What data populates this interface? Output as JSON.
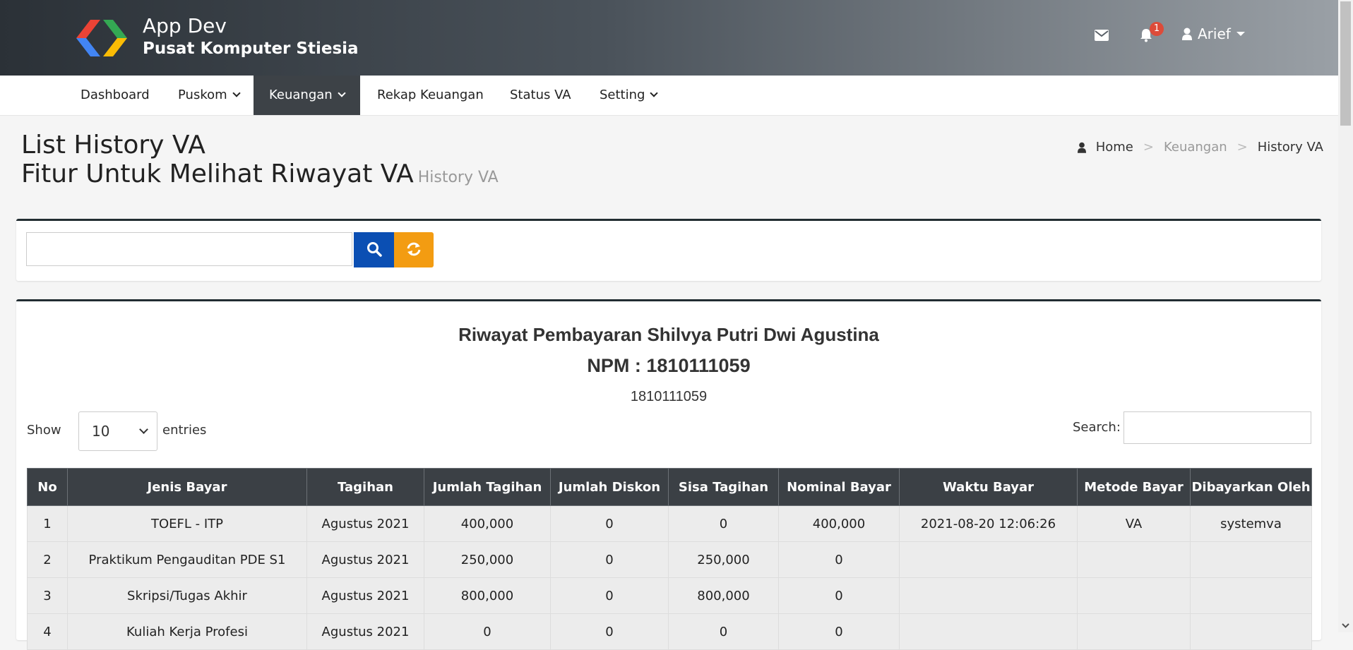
{
  "app": {
    "title": "App Dev",
    "subtitle": "Pusat Komputer Stiesia",
    "notification_count": "1",
    "user_name": "Arief"
  },
  "nav": {
    "items": [
      {
        "label": "Dashboard",
        "has_dropdown": false,
        "active": false
      },
      {
        "label": "Puskom",
        "has_dropdown": true,
        "active": false
      },
      {
        "label": "Keuangan",
        "has_dropdown": true,
        "active": true
      },
      {
        "label": "Rekap Keuangan",
        "has_dropdown": false,
        "active": false
      },
      {
        "label": "Status VA",
        "has_dropdown": false,
        "active": false
      },
      {
        "label": "Setting",
        "has_dropdown": true,
        "active": false
      }
    ]
  },
  "page": {
    "title": "List History VA",
    "heading": "Fitur Untuk Melihat Riwayat VA",
    "subheading": "History VA"
  },
  "breadcrumb": {
    "home": "Home",
    "section": "Keuangan",
    "current": "History VA"
  },
  "search": {
    "value": "",
    "placeholder": ""
  },
  "report": {
    "title": "Riwayat Pembayaran Shilvya Putri Dwi Agustina",
    "npm_line": "NPM : 1810111059",
    "npm_plain": "1810111059"
  },
  "datatable": {
    "show_label": "Show",
    "entries_value": "10",
    "entries_label": "entries",
    "search_label": "Search:",
    "columns": [
      "No",
      "Jenis Bayar",
      "Tagihan",
      "Jumlah Tagihan",
      "Jumlah Diskon",
      "Sisa Tagihan",
      "Nominal Bayar",
      "Waktu Bayar",
      "Metode Bayar",
      "Dibayarkan Oleh"
    ],
    "rows": [
      [
        "1",
        "TOEFL - ITP",
        "Agustus 2021",
        "400,000",
        "0",
        "0",
        "400,000",
        "2021-08-20 12:06:26",
        "VA",
        "systemva"
      ],
      [
        "2",
        "Praktikum Pengauditan PDE S1",
        "Agustus 2021",
        "250,000",
        "0",
        "250,000",
        "0",
        "",
        "",
        ""
      ],
      [
        "3",
        "Skripsi/Tugas Akhir",
        "Agustus 2021",
        "800,000",
        "0",
        "800,000",
        "0",
        "",
        "",
        ""
      ],
      [
        "4",
        "Kuliah Kerja Profesi",
        "Agustus 2021",
        "0",
        "0",
        "0",
        "0",
        "",
        "",
        ""
      ]
    ]
  },
  "colors": {
    "header_dark": "#2b3137",
    "nav_active": "#3d4247",
    "btn_search": "#0b4fb3",
    "btn_refresh": "#f39c12",
    "table_header": "#3b4045",
    "badge": "#dd4b39"
  }
}
